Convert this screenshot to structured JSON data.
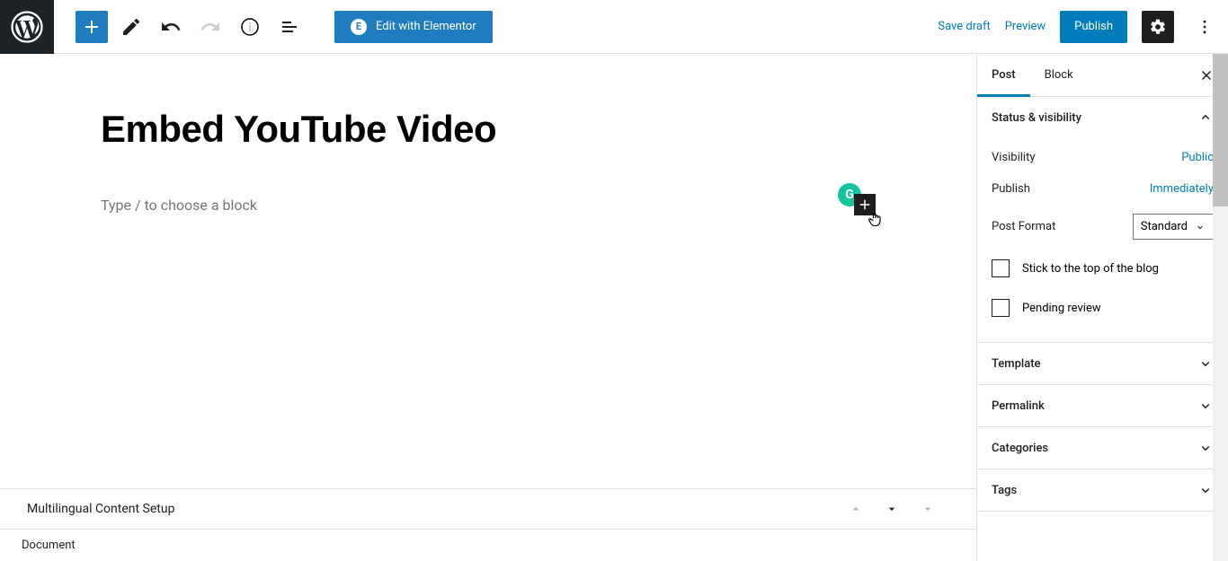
{
  "toolbar": {
    "elementor_label": "Edit with Elementor",
    "save_draft": "Save draft",
    "preview": "Preview",
    "publish": "Publish"
  },
  "editor": {
    "title": "Embed YouTube Video",
    "block_placeholder": "Type / to choose a block"
  },
  "bottom": {
    "multilingual": "Multilingual Content Setup",
    "document": "Document"
  },
  "sidebar": {
    "tabs": {
      "post": "Post",
      "block": "Block"
    },
    "status": {
      "title": "Status & visibility",
      "visibility_label": "Visibility",
      "visibility_value": "Public",
      "publish_label": "Publish",
      "publish_value": "Immediately",
      "format_label": "Post Format",
      "format_value": "Standard",
      "stick_label": "Stick to the top of the blog",
      "pending_label": "Pending review"
    },
    "panels": {
      "template": "Template",
      "permalink": "Permalink",
      "categories": "Categories",
      "tags": "Tags"
    }
  }
}
